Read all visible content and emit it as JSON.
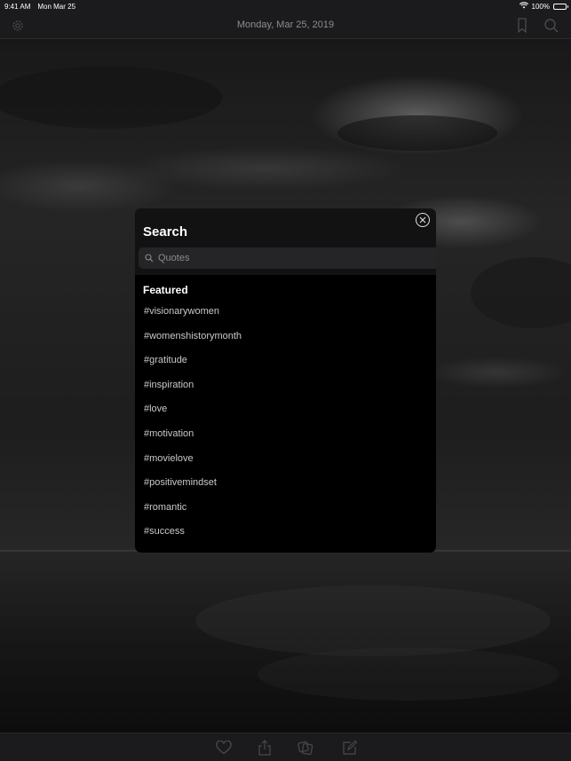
{
  "status_bar": {
    "time": "9:41 AM",
    "date": "Mon Mar 25",
    "battery": "100%",
    "wifi_icon": "wifi-icon",
    "battery_icon": "battery-icon"
  },
  "nav_bar": {
    "title": "Monday, Mar 25, 2019",
    "left_icon": "gear-icon",
    "right_icons": [
      "bookmark-icon",
      "search-icon"
    ]
  },
  "search_modal": {
    "title": "Search",
    "close_icon": "close-icon",
    "search_placeholder": "Quotes",
    "search_value": "",
    "section_title": "Featured",
    "tags": [
      "#visionarywomen",
      "#womenshistorymonth",
      "#gratitude",
      "#inspiration",
      "#love",
      "#motivation",
      "#movielove",
      "#positivemindset",
      "#romantic",
      "#success"
    ]
  },
  "toolbar": {
    "icons": [
      "heart-icon",
      "share-icon",
      "theme-icon",
      "edit-icon"
    ]
  },
  "colors": {
    "bar_background": "#1b1b1d",
    "modal_background": "#000000",
    "search_field": "#252527",
    "tag_text": "#c9c9cc",
    "nav_title": "#8d8d92"
  }
}
